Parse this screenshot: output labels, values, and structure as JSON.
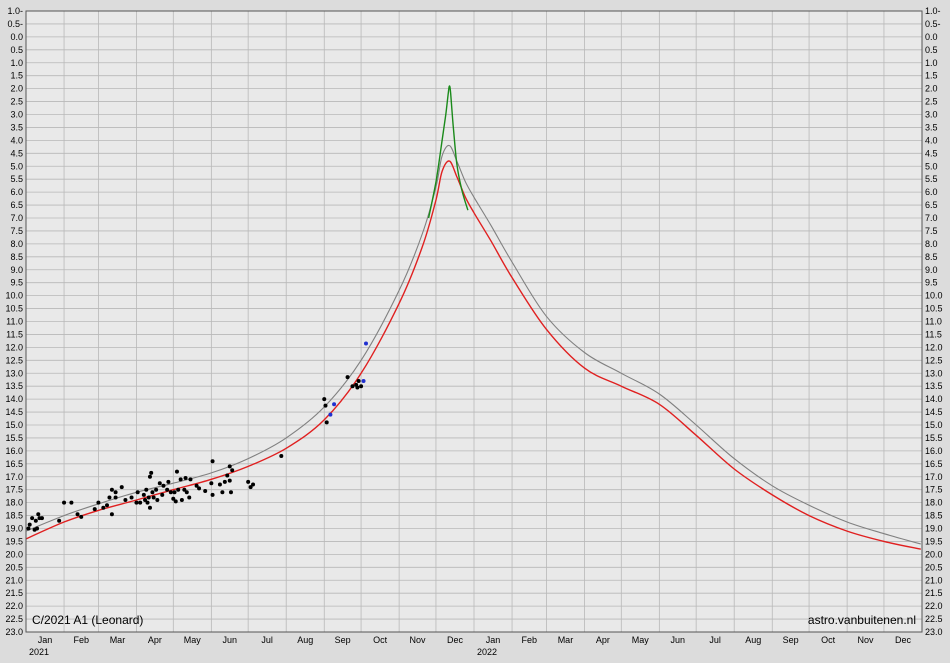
{
  "chart_data": {
    "type": "line",
    "title": "C/2021 A1 (Leonard)",
    "credit": "astro.vanbuitenen.nl",
    "ylim": [
      23.0,
      -1.0
    ],
    "y_inverted": true,
    "y_tick_step": 0.5,
    "y_tick_labels": [
      "1.0-",
      "0.5-",
      "0.0",
      "0.5",
      "1.0",
      "1.5",
      "2.0",
      "2.5",
      "3.0",
      "3.5",
      "4.0",
      "4.5",
      "5.0",
      "5.5",
      "6.0",
      "6.5",
      "7.0",
      "7.5",
      "8.0",
      "8.5",
      "9.0",
      "9.5",
      "10.0",
      "10.5",
      "11.0",
      "11.5",
      "12.0",
      "12.5",
      "13.0",
      "13.5",
      "14.0",
      "14.5",
      "15.0",
      "15.5",
      "16.0",
      "16.5",
      "17.0",
      "17.5",
      "18.0",
      "18.5",
      "19.0",
      "19.5",
      "20.0",
      "20.5",
      "21.0",
      "21.5",
      "22.0",
      "22.5",
      "23.0"
    ],
    "x_domain": [
      "2021-01-01",
      "2022-12-31"
    ],
    "x_month_labels": [
      "Jan",
      "Feb",
      "Mar",
      "Apr",
      "May",
      "Jun",
      "Jul",
      "Aug",
      "Sep",
      "Oct",
      "Nov",
      "Dec",
      "Jan",
      "Feb",
      "Mar",
      "Apr",
      "May",
      "Jun",
      "Jul",
      "Aug",
      "Sep",
      "Oct",
      "Nov",
      "Dec"
    ],
    "x_year_labels": [
      {
        "date": "2021-01-01",
        "label": "2021"
      },
      {
        "date": "2022-01-01",
        "label": "2022"
      }
    ],
    "grid": true,
    "series": [
      {
        "color": "#808080",
        "kind": "line",
        "points": [
          [
            "2021-01-01",
            19.1
          ],
          [
            "2021-02-01",
            18.5
          ],
          [
            "2021-03-01",
            18.05
          ],
          [
            "2021-04-01",
            17.6
          ],
          [
            "2021-05-01",
            17.25
          ],
          [
            "2021-06-01",
            16.85
          ],
          [
            "2021-07-01",
            16.3
          ],
          [
            "2021-08-01",
            15.5
          ],
          [
            "2021-09-01",
            14.3
          ],
          [
            "2021-10-01",
            12.5
          ],
          [
            "2021-11-01",
            9.8
          ],
          [
            "2021-11-20",
            7.6
          ],
          [
            "2021-12-01",
            5.8
          ],
          [
            "2021-12-06",
            4.6
          ],
          [
            "2021-12-12",
            4.2
          ],
          [
            "2021-12-18",
            4.8
          ],
          [
            "2021-12-25",
            5.6
          ],
          [
            "2022-01-01",
            6.2
          ],
          [
            "2022-01-15",
            7.3
          ],
          [
            "2022-02-01",
            8.7
          ],
          [
            "2022-03-01",
            10.8
          ],
          [
            "2022-04-01",
            12.2
          ],
          [
            "2022-05-01",
            13.0
          ],
          [
            "2022-06-01",
            13.8
          ],
          [
            "2022-07-01",
            15.0
          ],
          [
            "2022-08-01",
            16.3
          ],
          [
            "2022-09-01",
            17.35
          ],
          [
            "2022-10-01",
            18.1
          ],
          [
            "2022-11-01",
            18.75
          ],
          [
            "2022-12-01",
            19.2
          ],
          [
            "2022-12-31",
            19.6
          ]
        ]
      },
      {
        "color": "#e02020",
        "kind": "line",
        "points": [
          [
            "2021-01-01",
            19.4
          ],
          [
            "2021-02-01",
            18.75
          ],
          [
            "2021-03-01",
            18.3
          ],
          [
            "2021-04-01",
            17.9
          ],
          [
            "2021-05-01",
            17.5
          ],
          [
            "2021-06-01",
            17.1
          ],
          [
            "2021-07-01",
            16.6
          ],
          [
            "2021-08-01",
            15.9
          ],
          [
            "2021-09-01",
            14.8
          ],
          [
            "2021-10-01",
            13.0
          ],
          [
            "2021-11-01",
            10.3
          ],
          [
            "2021-11-20",
            8.1
          ],
          [
            "2021-12-01",
            6.3
          ],
          [
            "2021-12-06",
            5.2
          ],
          [
            "2021-12-12",
            4.8
          ],
          [
            "2021-12-18",
            5.4
          ],
          [
            "2021-12-25",
            6.2
          ],
          [
            "2022-01-01",
            6.8
          ],
          [
            "2022-01-15",
            7.9
          ],
          [
            "2022-02-01",
            9.3
          ],
          [
            "2022-03-01",
            11.3
          ],
          [
            "2022-04-01",
            12.8
          ],
          [
            "2022-05-01",
            13.5
          ],
          [
            "2022-06-01",
            14.2
          ],
          [
            "2022-07-01",
            15.4
          ],
          [
            "2022-08-01",
            16.7
          ],
          [
            "2022-09-01",
            17.7
          ],
          [
            "2022-10-01",
            18.5
          ],
          [
            "2022-11-01",
            19.1
          ],
          [
            "2022-12-01",
            19.5
          ],
          [
            "2022-12-31",
            19.8
          ]
        ]
      },
      {
        "color": "#1a8a1a",
        "kind": "line",
        "points": [
          [
            "2021-11-25",
            7.0
          ],
          [
            "2021-12-01",
            5.6
          ],
          [
            "2021-12-06",
            4.0
          ],
          [
            "2021-12-09",
            3.0
          ],
          [
            "2021-12-11",
            2.2
          ],
          [
            "2021-12-12",
            1.9
          ],
          [
            "2021-12-13",
            2.2
          ],
          [
            "2021-12-15",
            3.4
          ],
          [
            "2021-12-18",
            4.9
          ],
          [
            "2021-12-22",
            5.9
          ],
          [
            "2021-12-27",
            6.7
          ]
        ]
      },
      {
        "color": "#000000",
        "kind": "scatter",
        "points": [
          [
            "2021-01-03",
            19.0
          ],
          [
            "2021-01-04",
            18.85
          ],
          [
            "2021-01-06",
            18.6
          ],
          [
            "2021-01-08",
            19.05
          ],
          [
            "2021-01-09",
            18.7
          ],
          [
            "2021-01-11",
            18.45
          ],
          [
            "2021-01-12",
            18.6
          ],
          [
            "2021-01-14",
            18.6
          ],
          [
            "2021-01-10",
            19.0
          ],
          [
            "2021-01-28",
            18.7
          ],
          [
            "2021-02-01",
            18.0
          ],
          [
            "2021-02-07",
            18.0
          ],
          [
            "2021-02-12",
            18.45
          ],
          [
            "2021-02-15",
            18.55
          ],
          [
            "2021-02-26",
            18.25
          ],
          [
            "2021-03-01",
            18.0
          ],
          [
            "2021-03-05",
            18.2
          ],
          [
            "2021-03-08",
            18.1
          ],
          [
            "2021-03-10",
            17.8
          ],
          [
            "2021-03-12",
            18.45
          ],
          [
            "2021-03-12",
            17.5
          ],
          [
            "2021-03-15",
            17.6
          ],
          [
            "2021-03-15",
            17.8
          ],
          [
            "2021-03-20",
            17.4
          ],
          [
            "2021-03-23",
            17.9
          ],
          [
            "2021-03-28",
            17.8
          ],
          [
            "2021-04-01",
            18.0
          ],
          [
            "2021-04-02",
            17.6
          ],
          [
            "2021-04-04",
            18.0
          ],
          [
            "2021-04-07",
            17.7
          ],
          [
            "2021-04-08",
            17.9
          ],
          [
            "2021-04-09",
            17.5
          ],
          [
            "2021-04-10",
            18.0
          ],
          [
            "2021-04-11",
            17.8
          ],
          [
            "2021-04-12",
            17.0
          ],
          [
            "2021-04-12",
            18.2
          ],
          [
            "2021-04-13",
            16.85
          ],
          [
            "2021-04-14",
            17.6
          ],
          [
            "2021-04-15",
            17.8
          ],
          [
            "2021-04-17",
            17.5
          ],
          [
            "2021-04-18",
            17.9
          ],
          [
            "2021-04-20",
            17.25
          ],
          [
            "2021-04-22",
            17.7
          ],
          [
            "2021-04-23",
            17.35
          ],
          [
            "2021-04-26",
            17.5
          ],
          [
            "2021-04-27",
            17.2
          ],
          [
            "2021-04-29",
            17.6
          ],
          [
            "2021-05-01",
            17.85
          ],
          [
            "2021-05-02",
            17.6
          ],
          [
            "2021-05-03",
            17.95
          ],
          [
            "2021-05-04",
            16.8
          ],
          [
            "2021-05-05",
            17.5
          ],
          [
            "2021-05-07",
            17.1
          ],
          [
            "2021-05-08",
            17.9
          ],
          [
            "2021-05-10",
            17.5
          ],
          [
            "2021-05-11",
            17.05
          ],
          [
            "2021-05-12",
            17.6
          ],
          [
            "2021-05-14",
            17.8
          ],
          [
            "2021-05-15",
            17.1
          ],
          [
            "2021-05-20",
            17.35
          ],
          [
            "2021-05-22",
            17.45
          ],
          [
            "2021-05-27",
            17.55
          ],
          [
            "2021-06-01",
            17.25
          ],
          [
            "2021-06-02",
            17.7
          ],
          [
            "2021-06-02",
            16.4
          ],
          [
            "2021-06-08",
            17.3
          ],
          [
            "2021-06-10",
            17.6
          ],
          [
            "2021-06-12",
            17.2
          ],
          [
            "2021-06-14",
            16.95
          ],
          [
            "2021-06-16",
            16.6
          ],
          [
            "2021-06-16",
            17.15
          ],
          [
            "2021-06-17",
            17.6
          ],
          [
            "2021-06-18",
            16.75
          ],
          [
            "2021-07-01",
            17.2
          ],
          [
            "2021-07-03",
            17.4
          ],
          [
            "2021-07-05",
            17.3
          ],
          [
            "2021-07-28",
            16.2
          ],
          [
            "2021-09-01",
            14.0
          ],
          [
            "2021-09-02",
            14.25
          ],
          [
            "2021-09-03",
            14.9
          ],
          [
            "2021-09-20",
            13.15
          ],
          [
            "2021-09-24",
            13.5
          ],
          [
            "2021-09-27",
            13.45
          ],
          [
            "2021-09-28",
            13.55
          ],
          [
            "2021-09-29",
            13.3
          ],
          [
            "2021-10-01",
            13.5
          ]
        ]
      },
      {
        "color": "#2030d0",
        "kind": "scatter",
        "points": [
          [
            "2021-09-06",
            14.6
          ],
          [
            "2021-09-09",
            14.2
          ],
          [
            "2021-10-03",
            13.3
          ],
          [
            "2021-10-05",
            11.85
          ]
        ]
      }
    ]
  }
}
